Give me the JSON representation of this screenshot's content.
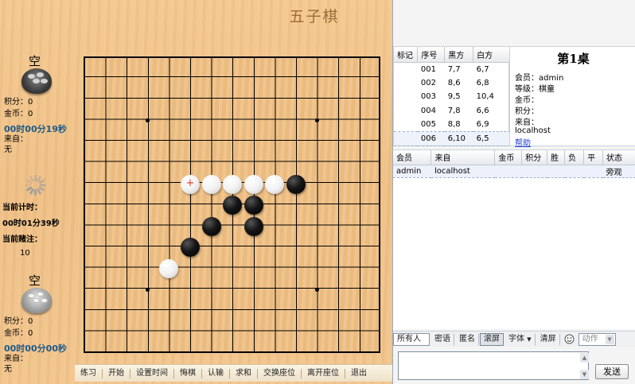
{
  "game_title": "五子棋",
  "players": [
    {
      "name": "空",
      "bowl": "black",
      "score_label": "积分：0",
      "coins_label": "金币：0",
      "time": "00时00分19秒",
      "from_label": "来自：",
      "from_value": "无"
    },
    {
      "name": "空",
      "bowl": "white",
      "score_label": "积分：0",
      "coins_label": "金币：0",
      "time": "00时00分00秒",
      "from_label": "来自：",
      "from_value": "无"
    }
  ],
  "timer": {
    "label": "当前计时：",
    "value": "00时01分39秒",
    "bet_label": "当前赌注：",
    "bet_value": "10"
  },
  "board": {
    "size": 15,
    "stars": [
      [
        3,
        3
      ],
      [
        3,
        11
      ],
      [
        11,
        3
      ],
      [
        11,
        11
      ],
      [
        7,
        7
      ]
    ],
    "stones": [
      {
        "row": 6,
        "col": 5,
        "color": "w",
        "marked": true
      },
      {
        "row": 6,
        "col": 6,
        "color": "w"
      },
      {
        "row": 6,
        "col": 7,
        "color": "w"
      },
      {
        "row": 6,
        "col": 8,
        "color": "w"
      },
      {
        "row": 6,
        "col": 9,
        "color": "w"
      },
      {
        "row": 6,
        "col": 10,
        "color": "b"
      },
      {
        "row": 7,
        "col": 7,
        "color": "b"
      },
      {
        "row": 7,
        "col": 8,
        "color": "b"
      },
      {
        "row": 8,
        "col": 6,
        "color": "b"
      },
      {
        "row": 8,
        "col": 8,
        "color": "b"
      },
      {
        "row": 9,
        "col": 5,
        "color": "b"
      },
      {
        "row": 10,
        "col": 4,
        "color": "w"
      }
    ],
    "mark_glyph": "+"
  },
  "toolbar": [
    "练习",
    "开始",
    "设置时间",
    "悔棋",
    "认输",
    "求和",
    "交换座位",
    "离开座位",
    "退出"
  ],
  "moves": {
    "headers": [
      "标记",
      "序号",
      "黑方",
      "白方"
    ],
    "rows": [
      [
        "",
        "001",
        "7,7",
        "6,7"
      ],
      [
        "",
        "002",
        "8,6",
        "6,8"
      ],
      [
        "",
        "003",
        "9,5",
        "10,4"
      ],
      [
        "",
        "004",
        "7,8",
        "6,6"
      ],
      [
        "",
        "005",
        "8,8",
        "6,9"
      ],
      [
        "",
        "006",
        "6,10",
        "6,5"
      ]
    ],
    "selected": 5
  },
  "table_info": {
    "title": "第1桌",
    "lines": [
      "会员：admin",
      "等级：棋童",
      "金币：",
      "积分：",
      "来自：",
      "localhost"
    ],
    "help": "帮助"
  },
  "members": {
    "headers": [
      "会员",
      "来自",
      "金币",
      "积分",
      "胜",
      "负",
      "平",
      "状态"
    ],
    "rows": [
      [
        "admin",
        "localhost",
        "",
        "",
        "",
        "",
        "",
        "旁观"
      ]
    ]
  },
  "chat": {
    "target": "所有人",
    "buttons": [
      "密语",
      "匿名",
      "滚屏",
      "字体",
      "清屏"
    ],
    "action": "动作",
    "send": "发送"
  },
  "colors": {
    "accent": "#1d5a8a",
    "link": "#1f3fd6",
    "wood": "#f0c186"
  }
}
